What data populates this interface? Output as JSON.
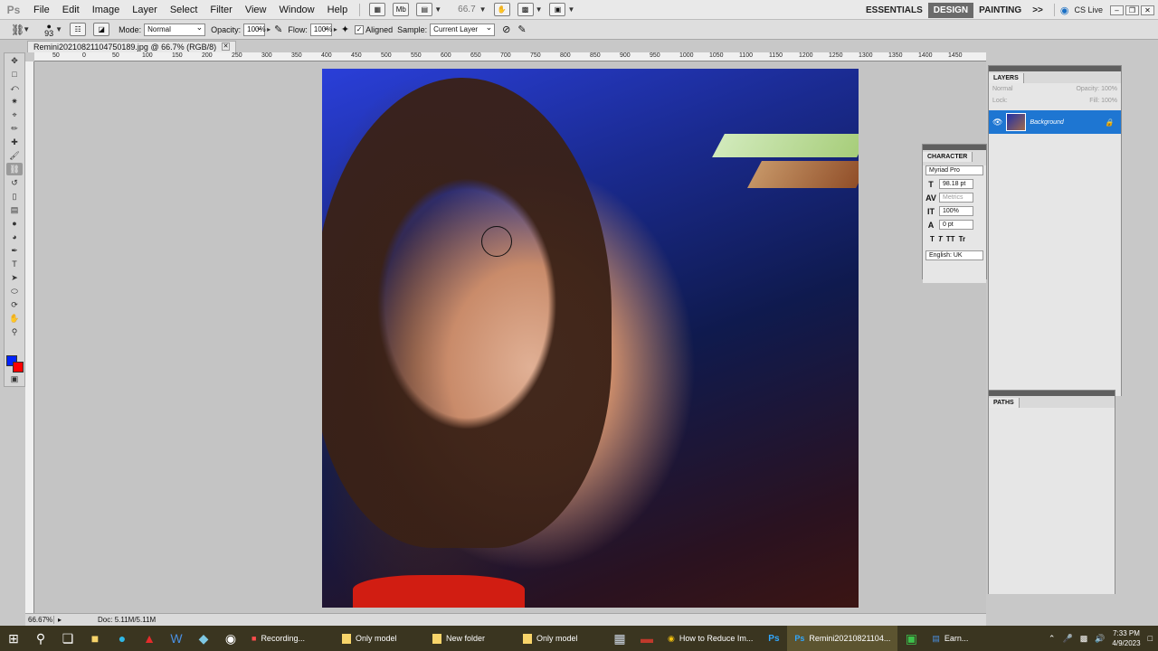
{
  "app": {
    "logo": "Ps",
    "menus": [
      "File",
      "Edit",
      "Image",
      "Layer",
      "Select",
      "Filter",
      "View",
      "Window",
      "Help"
    ],
    "zoom_readout": "66.7",
    "workspaces": [
      {
        "label": "ESSENTIALS",
        "active": false
      },
      {
        "label": "DESIGN",
        "active": true
      },
      {
        "label": "PAINTING",
        "active": false
      }
    ],
    "more": ">>",
    "cs_live": "CS Live"
  },
  "options": {
    "brush_size": "93",
    "mode_label": "Mode:",
    "mode_value": "Normal",
    "opacity_label": "Opacity:",
    "opacity_value": "100%",
    "flow_label": "Flow:",
    "flow_value": "100%",
    "aligned_label": "Aligned",
    "sample_label": "Sample:",
    "sample_value": "Current Layer"
  },
  "document": {
    "tab_title": "Remini20210821104750189.jpg @ 66.7% (RGB/8)",
    "ruler_labels": [
      "50",
      "0",
      "50",
      "100",
      "150",
      "200",
      "250",
      "300",
      "350",
      "400",
      "450",
      "500",
      "550",
      "600",
      "650",
      "700",
      "750",
      "800",
      "850",
      "900",
      "950",
      "1000",
      "1050",
      "1100",
      "1150",
      "1200",
      "1250",
      "1300",
      "1350",
      "1400",
      "1450"
    ]
  },
  "status": {
    "zoom": "66.67%",
    "doc_size": "Doc: 5.11M/5.11M"
  },
  "character_panel": {
    "tab": "CHARACTER",
    "font_family": "Myriad Pro",
    "font_size": "98.18 pt",
    "kerning": "Metrics",
    "vertical_scale": "100%",
    "baseline_shift": "0 pt",
    "styles": [
      "T",
      "T",
      "TT",
      "Tr"
    ],
    "language": "English: UK"
  },
  "layers_panel": {
    "tab": "LAYERS",
    "blend_mode": "Normal",
    "opacity_label": "Opacity:",
    "opacity_value": "100%",
    "lock_label": "Lock:",
    "fill_label": "Fill:",
    "fill_value": "100%",
    "layer_name": "Background"
  },
  "paths_panel": {
    "tab": "PATHS"
  },
  "taskbar": {
    "items": [
      {
        "label": "Recording...",
        "active": false
      },
      {
        "label": "Only model",
        "active": false
      },
      {
        "label": "New folder",
        "active": false
      },
      {
        "label": "Only model",
        "active": false
      },
      {
        "label": "How to Reduce Im...",
        "active": false
      },
      {
        "label": "Remini20210821104...",
        "active": true
      },
      {
        "label": "Earn...",
        "active": false
      }
    ],
    "time": "7:33 PM",
    "date": "4/9/2023"
  },
  "colors": {
    "foreground": "#0022ff",
    "background": "#ff0000",
    "selection": "#1e76d2"
  }
}
